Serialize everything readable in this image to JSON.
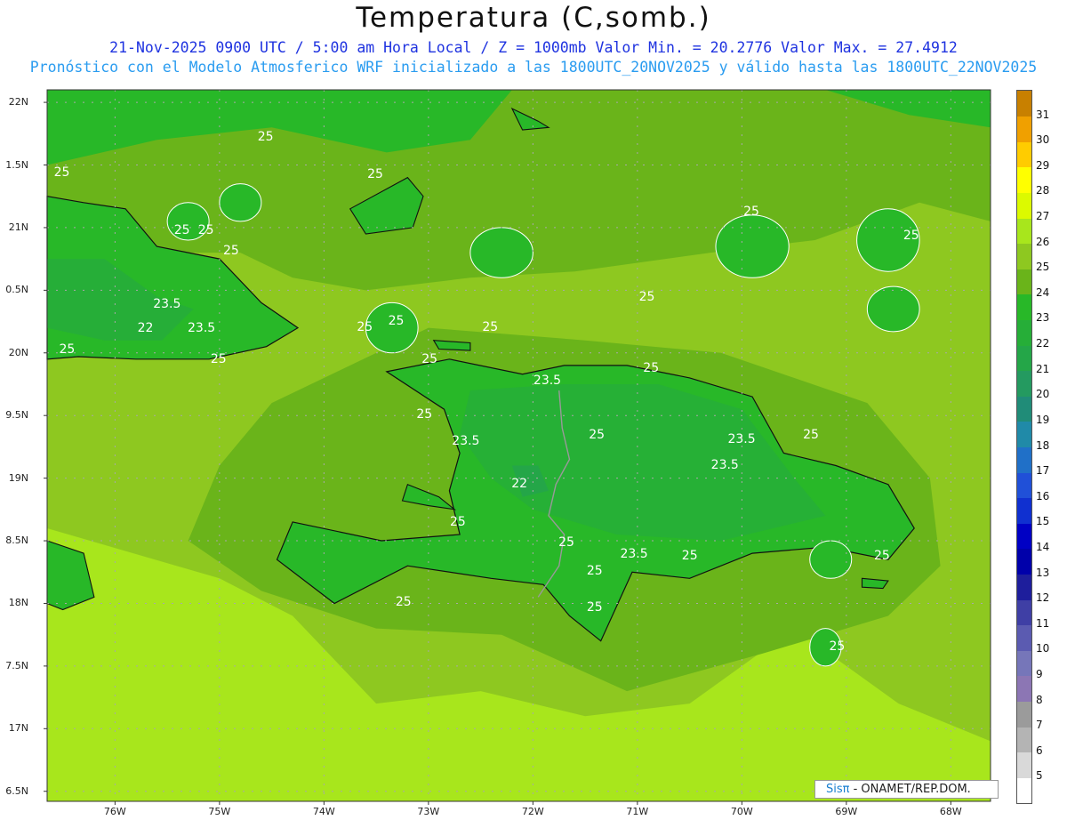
{
  "header": {
    "title": "Temperatura (C,somb.)",
    "line1": "21-Nov-2025  0900 UTC / 5:00 am Hora Local / Z = 1000mb   Valor Min. = 20.2776  Valor Max. = 27.4912",
    "line2": "Pronóstico con el Modelo Atmosferico WRF inicializado a las 1800UTC_20NOV2025 y válido hasta las  1800UTC_22NOV2025"
  },
  "credit": {
    "brand": "Sisπ",
    "org": " - ONAMET/REP.DOM."
  },
  "chart_data": {
    "type": "heatmap",
    "title": "Temperatura (C,somb.)",
    "variable": "Temperatura",
    "units": "C",
    "level": "Z = 1000mb",
    "valid_time": "21-Nov-2025 0900 UTC",
    "local_time": "5:00 am Hora Local",
    "value_min": 20.2776,
    "value_max": 27.4912,
    "xlim": [
      -76.65,
      -67.6
    ],
    "ylim": [
      16.4,
      22.1
    ],
    "x_ticks": [
      "76W",
      "75W",
      "74W",
      "73W",
      "72W",
      "71W",
      "70W",
      "69W",
      "68W"
    ],
    "y_ticks": [
      "22N",
      "21.5N",
      "21N",
      "20.5N",
      "20N",
      "19.5N",
      "19N",
      "18.5N",
      "18N",
      "17.5N",
      "17N",
      "16.5N"
    ],
    "y_tick_labels": [
      "22N",
      "1.5N",
      "21N",
      "0.5N",
      "20N",
      "9.5N",
      "19N",
      "8.5N",
      "18N",
      "7.5N",
      "17N",
      "6.5N"
    ],
    "colorbar_levels": [
      5,
      6,
      7,
      8,
      9,
      10,
      11,
      12,
      13,
      14,
      15,
      16,
      17,
      18,
      19,
      20,
      21,
      22,
      23,
      24,
      25,
      26,
      27,
      28,
      29,
      30,
      31
    ],
    "colorbar_colors": [
      "#ffffff",
      "#d9d9d9",
      "#b4b4b4",
      "#9b9b9b",
      "#8c76b4",
      "#7676b9",
      "#5b5bb1",
      "#3f3fa5",
      "#1e1e9c",
      "#0000aa",
      "#0000c4",
      "#1030d0",
      "#2050d8",
      "#2070c8",
      "#208aa8",
      "#208c78",
      "#249a60",
      "#24a648",
      "#26ae38",
      "#28b828",
      "#6ab41a",
      "#8ec820",
      "#a8e61c",
      "#dcfa00",
      "#ffff00",
      "#ffcc00",
      "#f0a000",
      "#c88000"
    ],
    "contour_labels": [
      "25",
      "23.5",
      "22"
    ],
    "contour_label_positions": [
      {
        "text": "25",
        "lon": -74.55,
        "lat": 21.72
      },
      {
        "text": "25",
        "lon": -73.5,
        "lat": 21.42
      },
      {
        "text": "25",
        "lon": -76.5,
        "lat": 21.43
      },
      {
        "text": "25",
        "lon": -75.35,
        "lat": 20.97
      },
      {
        "text": "25",
        "lon": -75.12,
        "lat": 20.97
      },
      {
        "text": "25",
        "lon": -74.88,
        "lat": 20.81
      },
      {
        "text": "25",
        "lon": -69.9,
        "lat": 21.12
      },
      {
        "text": "25",
        "lon": -68.37,
        "lat": 20.93
      },
      {
        "text": "25",
        "lon": -70.9,
        "lat": 20.44
      },
      {
        "text": "23.5",
        "lon": -75.55,
        "lat": 20.38
      },
      {
        "text": "22",
        "lon": -75.7,
        "lat": 20.19
      },
      {
        "text": "23.5",
        "lon": -75.22,
        "lat": 20.19
      },
      {
        "text": "25",
        "lon": -76.45,
        "lat": 20.02
      },
      {
        "text": "25",
        "lon": -75.0,
        "lat": 19.94
      },
      {
        "text": "25",
        "lon": -73.6,
        "lat": 20.2
      },
      {
        "text": "25",
        "lon": -73.3,
        "lat": 20.25
      },
      {
        "text": "25",
        "lon": -72.4,
        "lat": 20.2
      },
      {
        "text": "25",
        "lon": -72.98,
        "lat": 19.94
      },
      {
        "text": "23.5",
        "lon": -71.91,
        "lat": 19.77
      },
      {
        "text": "25",
        "lon": -70.86,
        "lat": 19.87
      },
      {
        "text": "25",
        "lon": -73.03,
        "lat": 19.5
      },
      {
        "text": "23.5",
        "lon": -72.69,
        "lat": 19.29
      },
      {
        "text": "25",
        "lon": -71.38,
        "lat": 19.34
      },
      {
        "text": "23.5",
        "lon": -70.05,
        "lat": 19.3
      },
      {
        "text": "25",
        "lon": -69.33,
        "lat": 19.34
      },
      {
        "text": "23.5",
        "lon": -70.21,
        "lat": 19.1
      },
      {
        "text": "22",
        "lon": -72.12,
        "lat": 18.95
      },
      {
        "text": "25",
        "lon": -72.71,
        "lat": 18.64
      },
      {
        "text": "25",
        "lon": -71.67,
        "lat": 18.48
      },
      {
        "text": "23.5",
        "lon": -71.08,
        "lat": 18.39
      },
      {
        "text": "25",
        "lon": -70.49,
        "lat": 18.37
      },
      {
        "text": "25",
        "lon": -68.65,
        "lat": 18.37
      },
      {
        "text": "25",
        "lon": -71.4,
        "lat": 18.25
      },
      {
        "text": "25",
        "lon": -71.4,
        "lat": 17.96
      },
      {
        "text": "25",
        "lon": -73.23,
        "lat": 18.0
      },
      {
        "text": "25",
        "lon": -69.08,
        "lat": 17.65
      }
    ]
  }
}
